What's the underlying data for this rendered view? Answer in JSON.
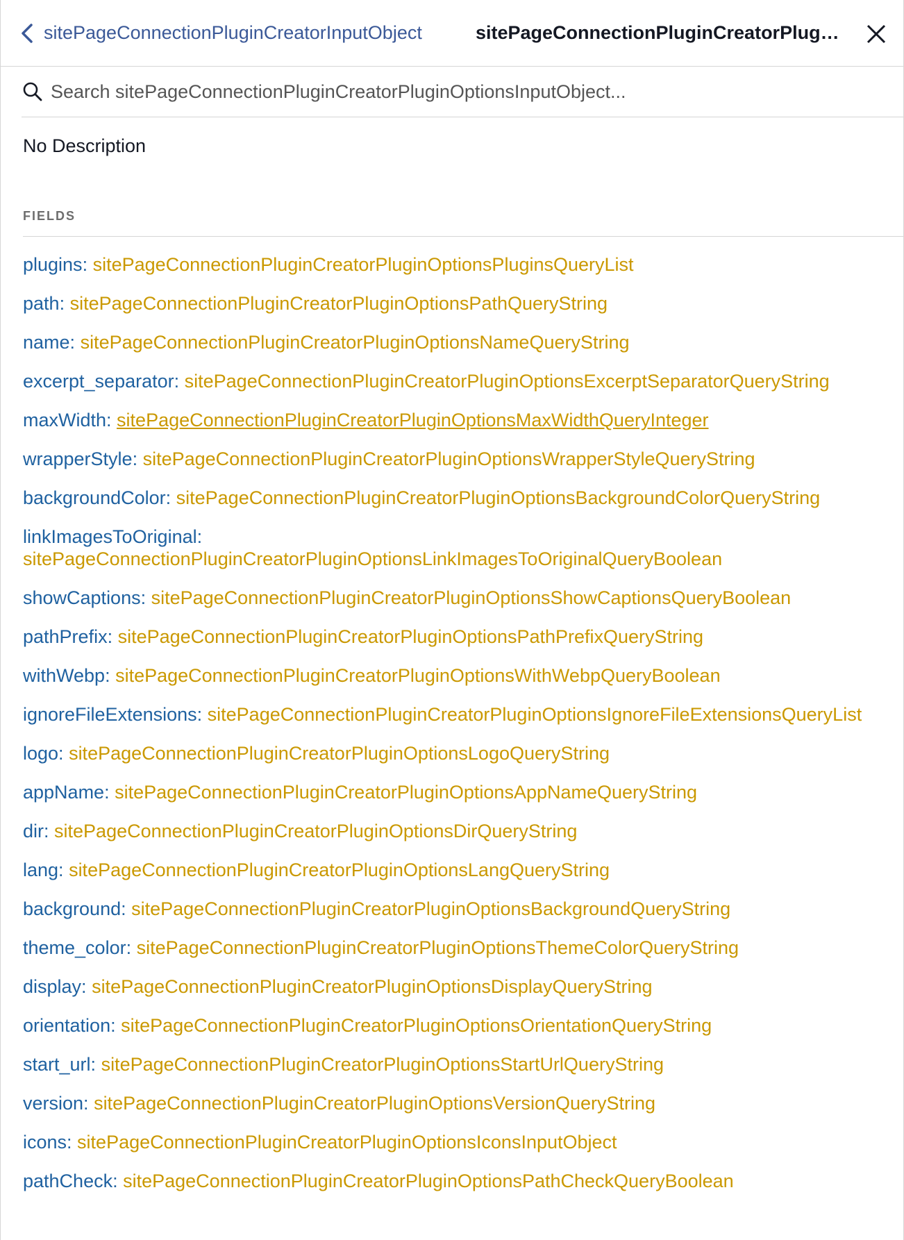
{
  "header": {
    "back_label": "sitePageConnectionPluginCreatorInputObject",
    "title": "sitePageConnectionPluginCreatorPluginOptionsInputObject"
  },
  "search": {
    "placeholder": "Search sitePageConnectionPluginCreatorPluginOptionsInputObject..."
  },
  "description": "No Description",
  "fields_title": "FIELDS",
  "fields": [
    {
      "name": "plugins",
      "type": "sitePageConnectionPluginCreatorPluginOptionsPluginsQueryList"
    },
    {
      "name": "path",
      "type": "sitePageConnectionPluginCreatorPluginOptionsPathQueryString"
    },
    {
      "name": "name",
      "type": "sitePageConnectionPluginCreatorPluginOptionsNameQueryString"
    },
    {
      "name": "excerpt_separator",
      "type": "sitePageConnectionPluginCreatorPluginOptionsExcerptSeparatorQueryString"
    },
    {
      "name": "maxWidth",
      "type": "sitePageConnectionPluginCreatorPluginOptionsMaxWidthQueryInteger"
    },
    {
      "name": "wrapperStyle",
      "type": "sitePageConnectionPluginCreatorPluginOptionsWrapperStyleQueryString"
    },
    {
      "name": "backgroundColor",
      "type": "sitePageConnectionPluginCreatorPluginOptionsBackgroundColorQueryString"
    },
    {
      "name": "linkImagesToOriginal",
      "type": "sitePageConnectionPluginCreatorPluginOptionsLinkImagesToOriginalQueryBoolean"
    },
    {
      "name": "showCaptions",
      "type": "sitePageConnectionPluginCreatorPluginOptionsShowCaptionsQueryBoolean"
    },
    {
      "name": "pathPrefix",
      "type": "sitePageConnectionPluginCreatorPluginOptionsPathPrefixQueryString"
    },
    {
      "name": "withWebp",
      "type": "sitePageConnectionPluginCreatorPluginOptionsWithWebpQueryBoolean"
    },
    {
      "name": "ignoreFileExtensions",
      "type": "sitePageConnectionPluginCreatorPluginOptionsIgnoreFileExtensionsQueryList"
    },
    {
      "name": "logo",
      "type": "sitePageConnectionPluginCreatorPluginOptionsLogoQueryString"
    },
    {
      "name": "appName",
      "type": "sitePageConnectionPluginCreatorPluginOptionsAppNameQueryString"
    },
    {
      "name": "dir",
      "type": "sitePageConnectionPluginCreatorPluginOptionsDirQueryString"
    },
    {
      "name": "lang",
      "type": "sitePageConnectionPluginCreatorPluginOptionsLangQueryString"
    },
    {
      "name": "background",
      "type": "sitePageConnectionPluginCreatorPluginOptionsBackgroundQueryString"
    },
    {
      "name": "theme_color",
      "type": "sitePageConnectionPluginCreatorPluginOptionsThemeColorQueryString"
    },
    {
      "name": "display",
      "type": "sitePageConnectionPluginCreatorPluginOptionsDisplayQueryString"
    },
    {
      "name": "orientation",
      "type": "sitePageConnectionPluginCreatorPluginOptionsOrientationQueryString"
    },
    {
      "name": "start_url",
      "type": "sitePageConnectionPluginCreatorPluginOptionsStartUrlQueryString"
    },
    {
      "name": "version",
      "type": "sitePageConnectionPluginCreatorPluginOptionsVersionQueryString"
    },
    {
      "name": "icons",
      "type": "sitePageConnectionPluginCreatorPluginOptionsIconsInputObject"
    },
    {
      "name": "pathCheck",
      "type": "sitePageConnectionPluginCreatorPluginOptionsPathCheckQueryBoolean"
    }
  ],
  "hovered_field_index": 4,
  "icons": {
    "back": "chevron-left-icon",
    "close": "close-icon",
    "search": "search-icon"
  },
  "colors": {
    "field_name": "#1f61a0",
    "field_type": "#ca9800",
    "back_link": "#3b5998",
    "section_title": "#6d6d6d"
  }
}
